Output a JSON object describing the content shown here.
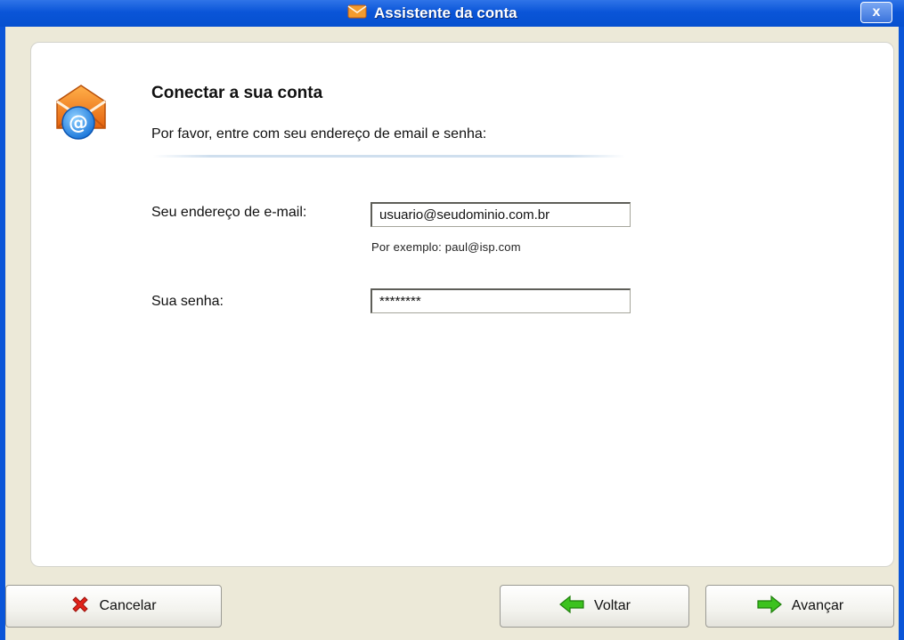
{
  "window": {
    "title": "Assistente da conta",
    "close_label": "x",
    "title_icon": "envelope-icon"
  },
  "header": {
    "icon": "email-at-icon",
    "heading": "Conectar a sua conta",
    "subtitle": "Por favor, entre com seu endereço de email e senha:"
  },
  "form": {
    "email": {
      "label": "Seu endereço de e-mail:",
      "value": "usuario@seudominio.com.br",
      "hint": "Por exemplo: paul@isp.com"
    },
    "password": {
      "label": "Sua senha:",
      "value": "********"
    }
  },
  "buttons": {
    "cancel": {
      "label": "Cancelar",
      "icon": "red-x-icon"
    },
    "back": {
      "label": "Voltar",
      "icon": "green-left-arrow-icon"
    },
    "next": {
      "label": "Avançar",
      "icon": "green-right-arrow-icon"
    }
  },
  "colors": {
    "titlebar": "#0a55d8",
    "background": "#ece9d8",
    "icon_orange": "#f07a18",
    "icon_blue": "#2a8ee8",
    "arrow_green": "#3cc21e",
    "cancel_red": "#e2231a"
  }
}
